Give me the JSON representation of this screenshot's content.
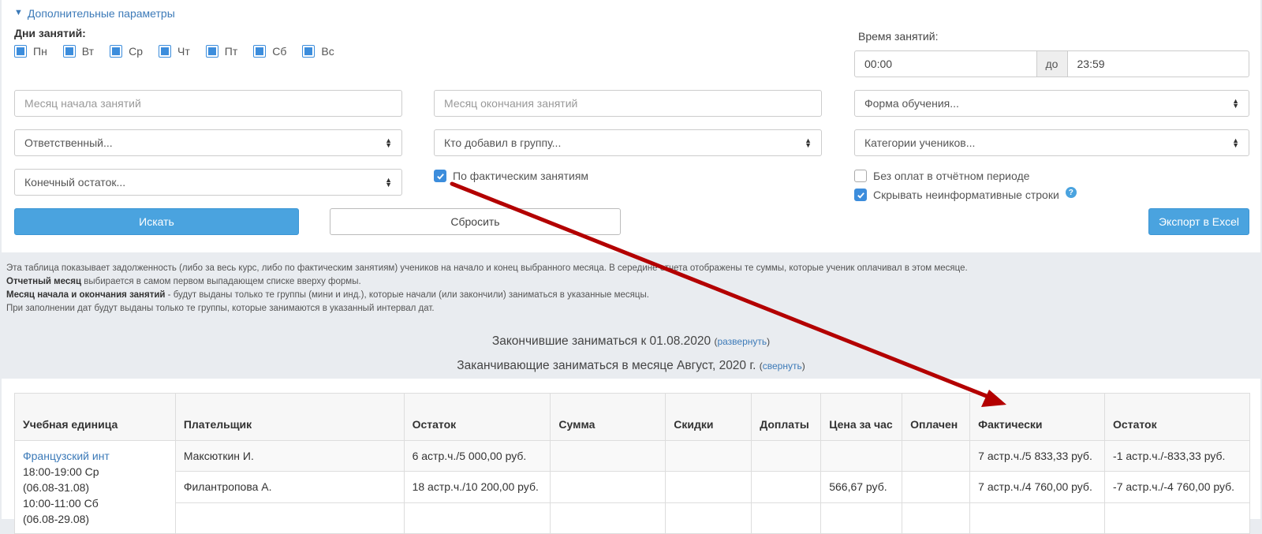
{
  "filters": {
    "toggle_label": "Дополнительные параметры",
    "days_label": "Дни занятий:",
    "days": [
      {
        "label": "Пн",
        "checked": true
      },
      {
        "label": "Вт",
        "checked": true
      },
      {
        "label": "Ср",
        "checked": true
      },
      {
        "label": "Чт",
        "checked": true
      },
      {
        "label": "Пт",
        "checked": true
      },
      {
        "label": "Сб",
        "checked": true
      },
      {
        "label": "Вс",
        "checked": true
      }
    ],
    "time_label": "Время занятий:",
    "time_from": "00:00",
    "time_sep": "до",
    "time_to": "23:59",
    "month_start_placeholder": "Месяц начала занятий",
    "month_end_placeholder": "Месяц окончания занятий",
    "form_select": "Форма обучения...",
    "responsible_select": "Ответственный...",
    "added_by_select": "Кто добавил в группу...",
    "student_categories_select": "Категории учеников...",
    "final_balance_select": "Конечный остаток...",
    "by_actual_lessons": {
      "label": "По фактическим занятиям",
      "checked": true
    },
    "no_payments": {
      "label": "Без оплат в отчётном периоде",
      "checked": false
    },
    "hide_rows": {
      "label": "Скрывать неинформативные строки",
      "checked": true
    },
    "help_glyph": "?",
    "search_button": "Искать",
    "reset_button": "Сбросить",
    "export_button": "Экспорт в Excel"
  },
  "info": {
    "line1": "Эта таблица показывает задолженность (либо за весь курс, либо по фактическим занятиям) учеников на начало и конец выбранного месяца. В середине отчета отображены те суммы, которые ученик оплачивал в этом месяце.",
    "line2_bold": "Отчетный месяц",
    "line2_rest": " выбирается в самом первом выпадающем списке вверху формы.",
    "line3_bold": "Месяц начала и окончания занятий",
    "line3_rest": " - будут выданы только те группы (мини и инд.), которые начали (или закончили) заниматься в указанные месяцы.",
    "line4": "При заполнении дат будут выданы только те группы, которые занимаются в указанный интервал дат."
  },
  "sections": {
    "finished_title": "Закончившие заниматься к 01.08.2020",
    "finished_link": "развернуть",
    "finishing_title": "Заканчивающие заниматься в месяце Август, 2020 г.",
    "finishing_link": "свернуть"
  },
  "table": {
    "headers": [
      "Учебная единица",
      "Плательщик",
      "Остаток",
      "Сумма",
      "Скидки",
      "Доплаты",
      "Цена за час",
      "Оплачен",
      "Фактически",
      "Остаток"
    ],
    "unit": {
      "name": "Французский инт",
      "schedule": [
        "18:00-19:00 Ср",
        "(06.08-31.08)",
        "10:00-11:00 Сб",
        "(06.08-29.08)"
      ]
    },
    "rows": [
      {
        "payer": "Максюткин И.",
        "balance": "6 астр.ч./5 000,00 руб.",
        "sum": "",
        "discounts": "",
        "extra": "",
        "price": "",
        "paid": "",
        "actual": "7 астр.ч./5 833,33 руб.",
        "remain": "-1 астр.ч./-833,33 руб."
      },
      {
        "payer": "Филантропова А.",
        "balance": "18 астр.ч./10 200,00 руб.",
        "sum": "",
        "discounts": "",
        "extra": "",
        "price": "566,67 руб.",
        "paid": "",
        "actual": "7 астр.ч./4 760,00 руб.",
        "remain": "-7 астр.ч./-4 760,00 руб."
      }
    ]
  },
  "colors": {
    "primary": "#4aa3df",
    "link": "#3c7ab8",
    "annotation_arrow": "#b30000"
  }
}
